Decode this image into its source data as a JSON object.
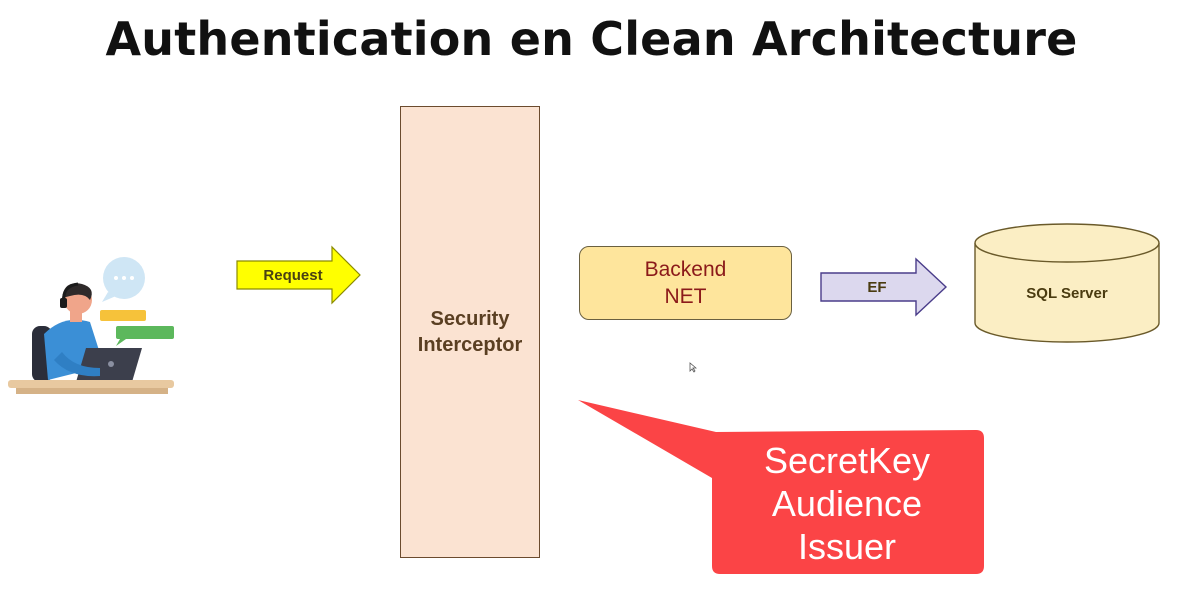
{
  "title": "Authentication en Clean Architecture",
  "request_arrow": {
    "label": "Request",
    "fill": "#ffff00"
  },
  "security_interceptor": {
    "label": "Security\nInterceptor"
  },
  "backend": {
    "label": "Backend\nNET"
  },
  "ef_arrow": {
    "label": "EF"
  },
  "database": {
    "label": "SQL Server"
  },
  "callout": {
    "text": "SecretKey\nAudience\nIssuer",
    "fill": "#fb4446"
  },
  "person_icon": "user-with-laptop-chat-icon"
}
